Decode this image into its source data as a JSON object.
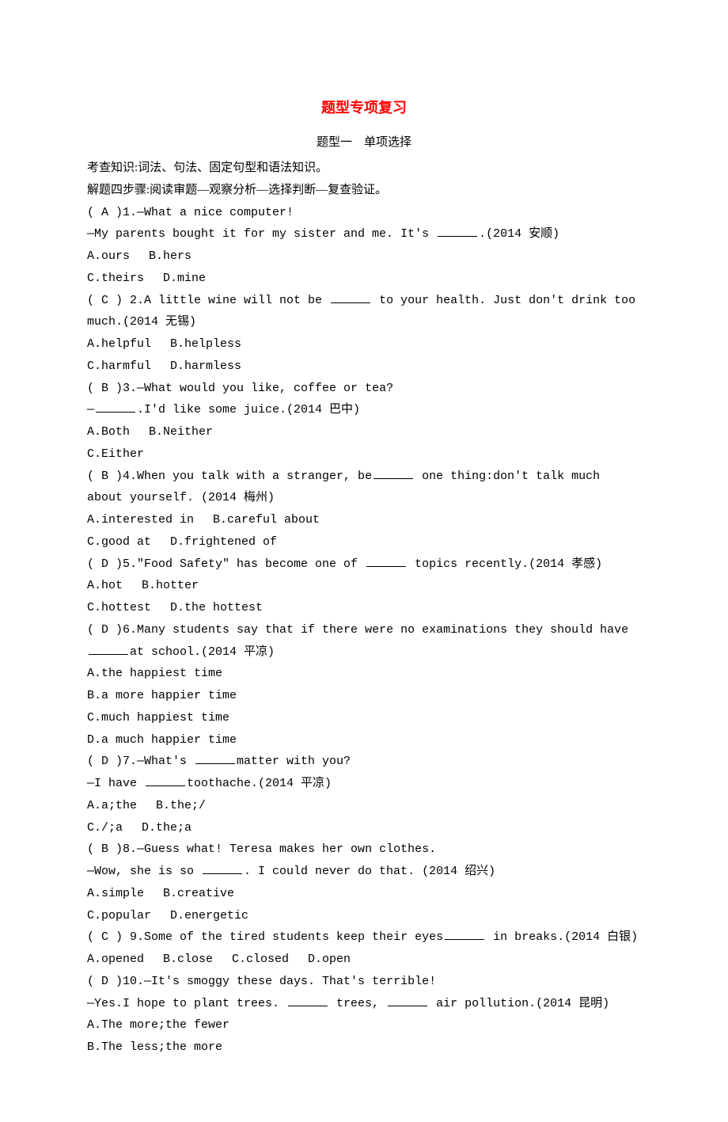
{
  "title": "题型专项复习",
  "subtitle": "题型一　单项选择",
  "intro1": "考查知识:词法、句法、固定句型和语法知识。",
  "intro2": "解题四步骤:阅读审题—观察分析—选择判断—复查验证。",
  "q1": {
    "num": "( A )1.",
    "stem1": "—What a nice computer!",
    "stem2_pre": "—My parents bought it for my sister and me. It's ",
    "stem2_post": ".(2014 安顺)",
    "optA": "A.ours",
    "optB": "B.hers",
    "optC": "C.theirs",
    "optD": "D.mine"
  },
  "q2": {
    "num": "( C ) 2.",
    "stem_pre": "A little wine will not be ",
    "stem_post": " to your health. Just don't drink too much.(2014 无锡)",
    "optA": "A.helpful",
    "optB": "B.helpless",
    "optC": "C.harmful",
    "optD": "D.harmless"
  },
  "q3": {
    "num": "( B )3.",
    "stem1": "—What would you like, coffee or tea?",
    "stem2_pre": "—",
    "stem2_post": ".I'd like some juice.(2014 巴中)",
    "optA": "A.Both",
    "optB": "B.Neither",
    "optC": "C.Either"
  },
  "q4": {
    "num": "( B )4.",
    "stem_pre": "When you talk with a stranger, be",
    "stem_post": " one thing:don't talk much about yourself. (2014 梅州)",
    "optA": "A.interested in",
    "optB": "B.careful about",
    "optC": "C.good at",
    "optD": "D.frightened of"
  },
  "q5": {
    "num": "( D )5.",
    "stem_pre": "\"Food Safety\" has become one of ",
    "stem_post": " topics recently.(2014 孝感)",
    "optA": "A.hot",
    "optB": "B.hotter",
    "optC": "C.hottest",
    "optD": "D.the hottest"
  },
  "q6": {
    "num": "( D )6.",
    "stem_pre": "Many students say that if there were no examinations they should have ",
    "stem_post": "at school.(2014 平凉)",
    "optA": "A.the happiest time",
    "optB": "B.a more happier time",
    "optC": "C.much happiest time",
    "optD": "D.a much happier time"
  },
  "q7": {
    "num": "( D )7.",
    "stem1_pre": "—What's ",
    "stem1_post": "matter with you?",
    "stem2_pre": "—I have ",
    "stem2_post": "toothache.(2014 平凉)",
    "optA": "A.a;the",
    "optB": "B.the;/",
    "optC": "C./;a",
    "optD": "D.the;a"
  },
  "q8": {
    "num": "( B )8.",
    "stem1": "—Guess what! Teresa makes her own clothes.",
    "stem2_pre": "—Wow, she is so ",
    "stem2_post": ". I could never do that. (2014 绍兴)",
    "optA": "A.simple",
    "optB": "B.creative",
    "optC": "C.popular",
    "optD": "D.energetic"
  },
  "q9": {
    "num": "( C ) 9.",
    "stem_pre": "Some of the tired students keep their eyes",
    "stem_post": " in breaks.(2014 白银)",
    "optA": "A.opened",
    "optB": "B.close",
    "optC": "C.closed",
    "optD": "D.open"
  },
  "q10": {
    "num": "( D )10.",
    "stem1": "—It's smoggy these days. That's terrible!",
    "stem2_pre": "—Yes.I hope to plant trees. ",
    "stem2_mid": " trees, ",
    "stem2_post": " air pollution.(2014 昆明)",
    "optA": "A.The more;the fewer",
    "optB": "B.The less;the more"
  }
}
